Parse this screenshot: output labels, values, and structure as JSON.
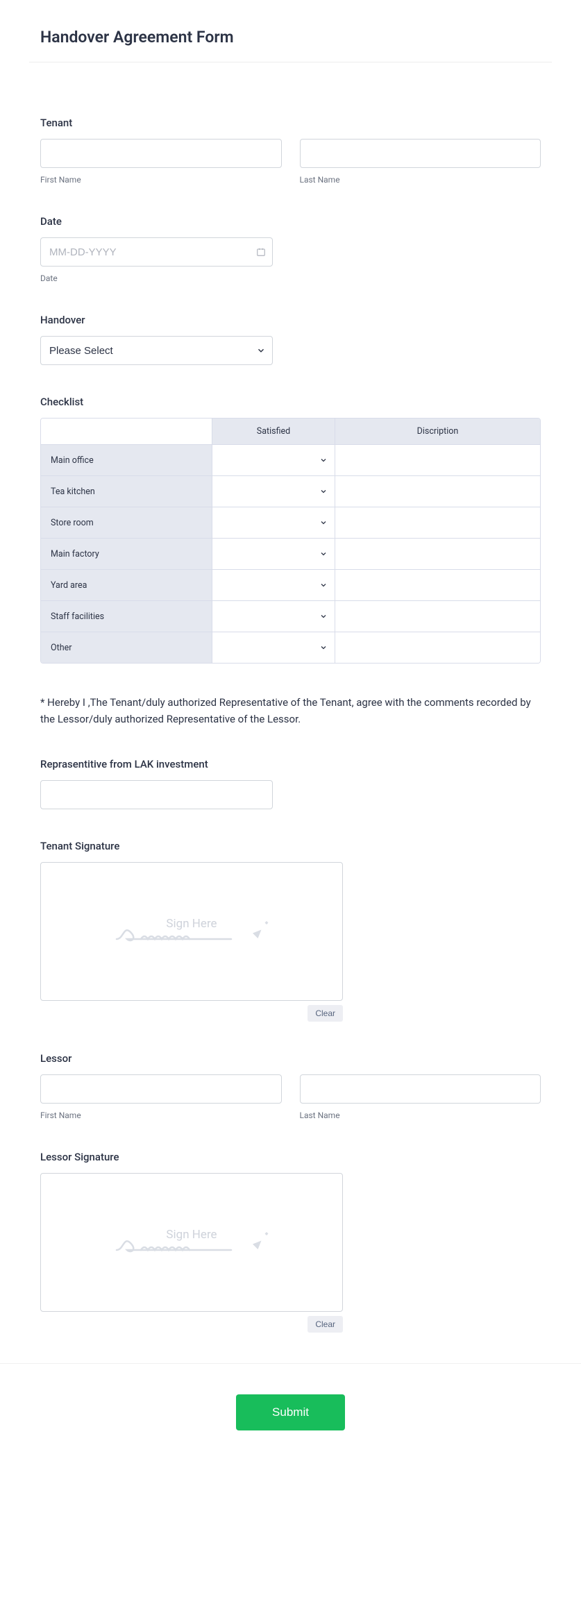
{
  "title": "Handover Agreement Form",
  "tenant": {
    "label": "Tenant",
    "first_name": "",
    "last_name": "",
    "first_sub": "First Name",
    "last_sub": "Last Name"
  },
  "date": {
    "label": "Date",
    "placeholder": "MM-DD-YYYY",
    "value": "",
    "sub": "Date"
  },
  "handover": {
    "label": "Handover",
    "value": "Please Select"
  },
  "checklist": {
    "label": "Checklist",
    "col_satisfied": "Satisfied",
    "col_description": "Discription",
    "rows": [
      {
        "name": "Main office"
      },
      {
        "name": "Tea kitchen"
      },
      {
        "name": "Store room"
      },
      {
        "name": "Main factory"
      },
      {
        "name": "Yard area"
      },
      {
        "name": "Staff facilities"
      },
      {
        "name": "Other"
      }
    ]
  },
  "agreement_text": "* Hereby I ,The Tenant/duly authorized Representative of the Tenant, agree with the comments recorded by the Lessor/duly authorized Representative of the Lessor.",
  "rep": {
    "label": "Reprasentitive from LAK investment",
    "value": ""
  },
  "tenant_sig": {
    "label": "Tenant Signature",
    "placeholder": "Sign Here",
    "clear": "Clear"
  },
  "lessor": {
    "label": "Lessor",
    "first_name": "",
    "last_name": "",
    "first_sub": "First Name",
    "last_sub": "Last Name"
  },
  "lessor_sig": {
    "label": "Lessor Signature",
    "placeholder": "Sign Here",
    "clear": "Clear"
  },
  "submit_label": "Submit"
}
